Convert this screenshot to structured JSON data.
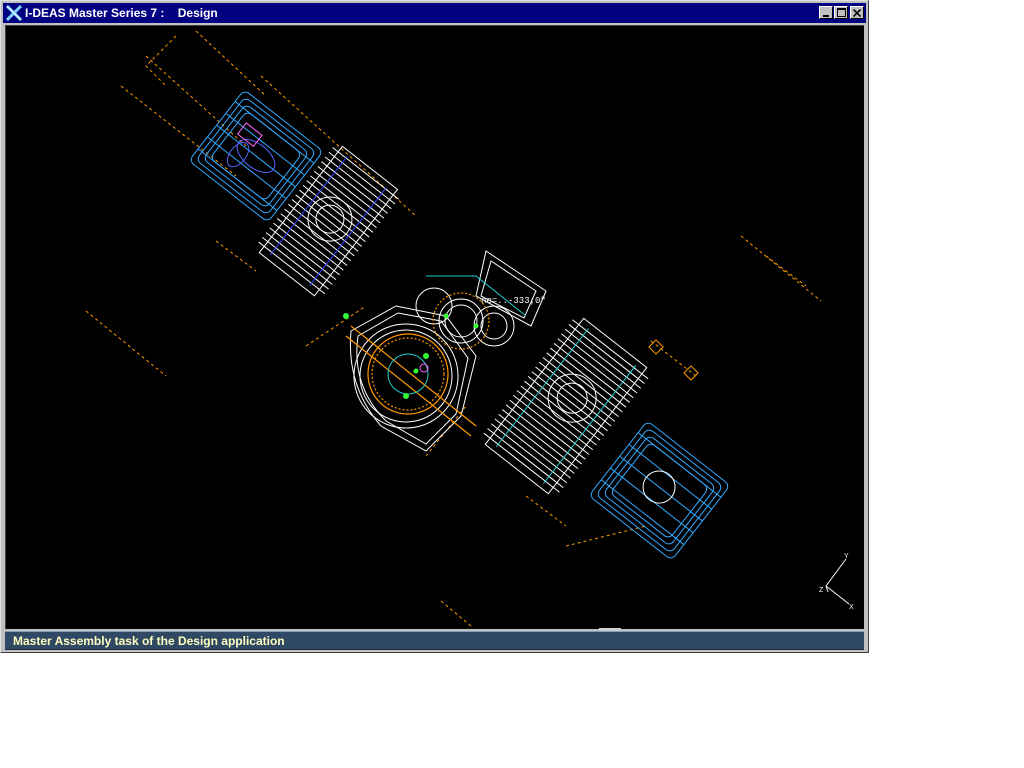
{
  "window": {
    "title": "I-DEAS Master Series 7 :    Design",
    "controls": {
      "minimize_icon": "minimize-icon",
      "maximize_icon": "maximize-icon",
      "close_icon": "close-icon"
    }
  },
  "viewport": {
    "coordinate_readout": "ne=..-333;0\"",
    "triad_labels": {
      "y": "Y",
      "z": "Z",
      "x": "X"
    }
  },
  "status_bar": {
    "message": "Master Assembly task of the Design application"
  },
  "colors": {
    "titlebar": "#000080",
    "viewport_bg": "#000000",
    "wire_white": "#ffffff",
    "wire_cyan": "#33aaff",
    "wire_orange": "#ff9900",
    "wire_green": "#33ff33",
    "status_bg": "#2f4863",
    "status_text": "#ffffc0"
  }
}
